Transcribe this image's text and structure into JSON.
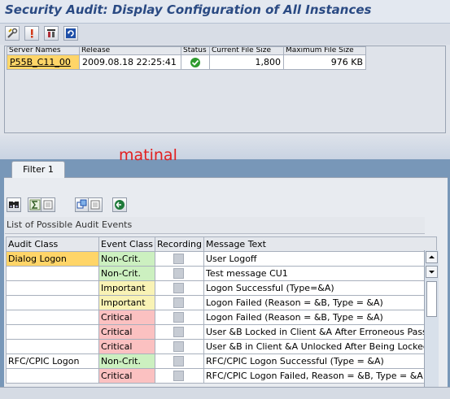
{
  "title": "Security Audit: Display Configuration of All Instances",
  "toolbar_icons": [
    "wrench-icon",
    "info-icon",
    "filter-icon",
    "refresh-icon"
  ],
  "instances": {
    "columns": [
      "Server Names",
      "Release",
      "Status",
      "Current File Size",
      "Maximum File Size"
    ],
    "rows": [
      {
        "server": "P55B_C11_00",
        "release": "2009.08.18 22:25:41",
        "status_icon": "green-check-icon",
        "current_size": "1,800",
        "max_size": "976 KB"
      }
    ]
  },
  "annotation": "matinal",
  "tab_label": "Filter 1",
  "events_toolbar_icons": [
    "binoculars-icon",
    "sum-icon",
    "subtotal-icon",
    "layout-icon",
    "export-icon",
    "execute-icon"
  ],
  "list_title": "List of Possible Audit Events",
  "events": {
    "columns": [
      "Audit Class",
      "Event Class",
      "Recording",
      "Message Text"
    ],
    "rows": [
      {
        "audit_class": "Dialog Logon",
        "event_class": "Non-Crit.",
        "message": "User Logoff"
      },
      {
        "audit_class": "",
        "event_class": "Non-Crit.",
        "message": "Test message CU1"
      },
      {
        "audit_class": "",
        "event_class": "Important",
        "message": "Logon Successful (Type=&A)"
      },
      {
        "audit_class": "",
        "event_class": "Important",
        "message": "Logon Failed (Reason = &B, Type = &A)"
      },
      {
        "audit_class": "",
        "event_class": "Critical",
        "message": "Logon Failed (Reason = &B, Type = &A)"
      },
      {
        "audit_class": "",
        "event_class": "Critical",
        "message": "User &B Locked in Client &A After Erroneous Passw"
      },
      {
        "audit_class": "",
        "event_class": "Critical",
        "message": "User &B in Client &A Unlocked After Being Locked"
      },
      {
        "audit_class": "RFC/CPIC Logon",
        "event_class": "Non-Crit.",
        "message": "RFC/CPIC Logon Successful (Type = &A)"
      },
      {
        "audit_class": "",
        "event_class": "Critical",
        "message": "RFC/CPIC Logon Failed, Reason = &B, Type = &A"
      }
    ]
  },
  "colors": {
    "title_text": "#2a4a83",
    "highlight": "#ffd568",
    "non_critical": "#ccf0c0",
    "important": "#f9f3b5",
    "critical": "#fbc1c1",
    "annotation": "#e21f1f",
    "background_blue": "#7897b8"
  }
}
